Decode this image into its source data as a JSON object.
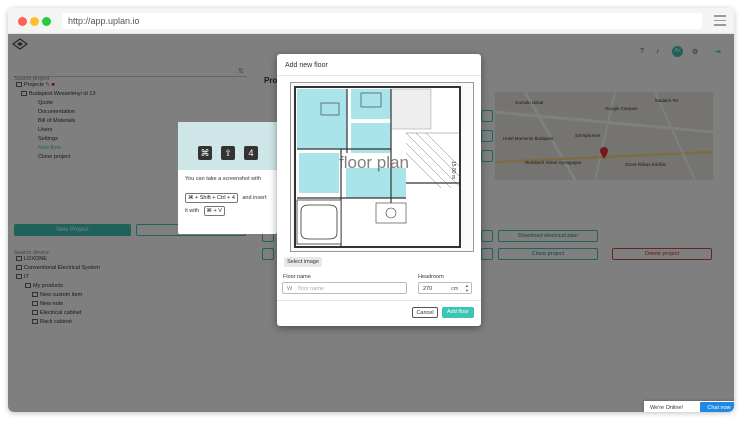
{
  "browser": {
    "url": "http://app.uplan.io"
  },
  "sidebar": {
    "search_project_placeholder": "Search project",
    "tree": [
      {
        "label": "Projects",
        "level": 0
      },
      {
        "label": "Budapest Wesselényi út 13",
        "level": 1
      },
      {
        "label": "Quote",
        "level": 2
      },
      {
        "label": "Documentation",
        "level": 2
      },
      {
        "label": "Bill of Materials",
        "level": 2
      },
      {
        "label": "Users",
        "level": 2
      },
      {
        "label": "Settings",
        "level": 2
      },
      {
        "label": "New floor",
        "level": 2
      },
      {
        "label": "Clone project",
        "level": 2
      }
    ],
    "new_project_label": "New Project",
    "search_device_placeholder": "Search device",
    "devices": [
      {
        "label": "LOXONE",
        "level": 0
      },
      {
        "label": "Conventional Electrical System",
        "level": 0
      },
      {
        "label": "IT",
        "level": 0
      },
      {
        "label": "My products",
        "level": 0
      },
      {
        "label": "New custom item",
        "level": 1
      },
      {
        "label": "New note",
        "level": 1
      },
      {
        "label": "Electrical cabinet",
        "level": 1
      },
      {
        "label": "Rack cabinet",
        "level": 1
      }
    ]
  },
  "header": {
    "title_partial": "Pro",
    "avatar_initials": "AV"
  },
  "main": {
    "download_electrical_plan_label": "Download electrical plan",
    "clone_project_label": "Clone project",
    "delete_project_label": "Delete project",
    "map_labels": [
      {
        "text": "Gozsdu Udvar"
      },
      {
        "text": "Google Campus"
      },
      {
        "text": "Madach Ter"
      },
      {
        "text": "Hotel Moments Budapest"
      },
      {
        "text": "Szimpla Kert"
      },
      {
        "text": "Rumbach Street Synagogue"
      },
      {
        "text": "Szent Rókus Kórház"
      }
    ]
  },
  "tooltip": {
    "line1": "You can take a screenshot with",
    "shortcut1": "⌘ + Shift + Ctrl + 4",
    "line2": "and insert",
    "line3": "it with",
    "shortcut2": "⌘ + V",
    "keys": [
      "⌘",
      "⇧",
      "4"
    ]
  },
  "modal": {
    "title": "Add new floor",
    "floor_plan_watermark": "floor plan",
    "dimension_label": "15.80 m",
    "select_image_label": "Select image",
    "floor_name_label": "Floor name",
    "floor_name_placeholder": "floor name",
    "floor_name_prefix": "W",
    "headroom_label": "Headroom",
    "headroom_value": "270",
    "headroom_unit": "cm",
    "cancel_label": "Cancel",
    "add_floor_label": "Add floor"
  },
  "chat": {
    "status": "We're Online!",
    "button_label": "Chat now"
  },
  "colors": {
    "accent": "#3cc4b4",
    "danger": "#d44444",
    "mac_red": "#ff5f56",
    "mac_yellow": "#ffbd2e",
    "mac_green": "#27c93f"
  }
}
